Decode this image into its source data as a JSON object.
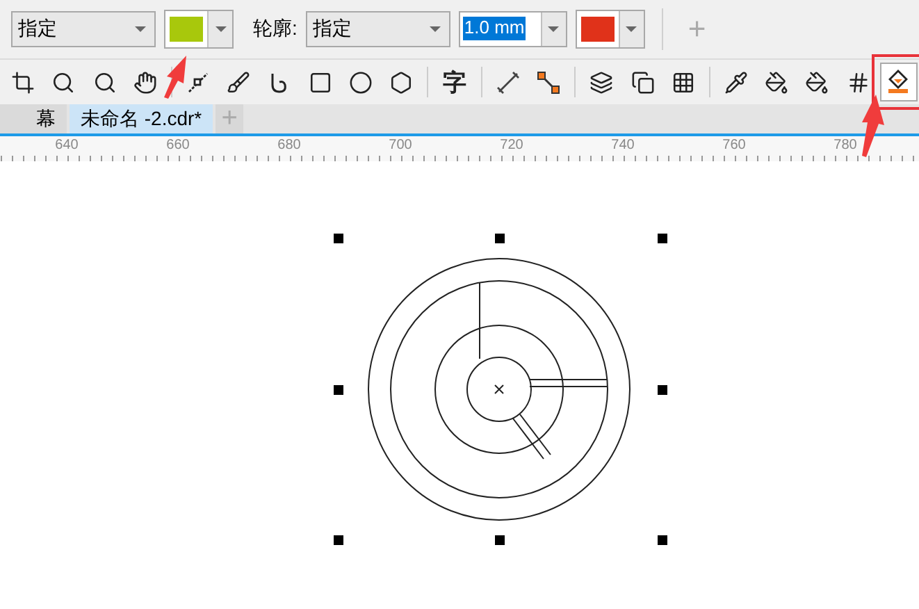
{
  "property_bar": {
    "fill_dropdown": {
      "value": "指定"
    },
    "fill_color": {
      "color": "#a8c80c"
    },
    "outline_label": "轮廓:",
    "outline_dropdown": {
      "value": "指定"
    },
    "outline_width": {
      "value": "1.0 mm",
      "selected": true
    },
    "outline_color": {
      "color": "#e0321a"
    },
    "add_button": "+"
  },
  "toolbar": [
    {
      "kind": "crop",
      "selected": false
    },
    {
      "kind": "zoom",
      "selected": false
    },
    {
      "kind": "zoom",
      "selected": false
    },
    {
      "kind": "hand",
      "selected": false
    },
    {
      "kind": "sep"
    },
    {
      "kind": "line",
      "selected": false
    },
    {
      "kind": "brush",
      "selected": false
    },
    {
      "kind": "curve",
      "selected": false
    },
    {
      "kind": "rect",
      "selected": false
    },
    {
      "kind": "ellipse",
      "selected": false
    },
    {
      "kind": "polygon",
      "selected": false
    },
    {
      "kind": "sep"
    },
    {
      "kind": "text",
      "label": "字",
      "selected": false
    },
    {
      "kind": "sep"
    },
    {
      "kind": "dimension",
      "selected": false
    },
    {
      "kind": "connector",
      "selected": false
    },
    {
      "kind": "sep"
    },
    {
      "kind": "blend",
      "selected": false
    },
    {
      "kind": "shadow",
      "selected": false
    },
    {
      "kind": "transparency",
      "selected": false
    },
    {
      "kind": "sep"
    },
    {
      "kind": "eyedropper",
      "selected": false
    },
    {
      "kind": "fill",
      "selected": false
    },
    {
      "kind": "fill",
      "selected": false
    },
    {
      "kind": "grid",
      "selected": false
    },
    {
      "kind": "smartfill",
      "selected": true
    }
  ],
  "tabs": [
    {
      "label": "幕",
      "selected": false
    },
    {
      "label": "未命名 -2.cdr*",
      "selected": true
    }
  ],
  "new_tab_button": "+",
  "ruler": {
    "labels": [
      "640",
      "660",
      "680",
      "700",
      "720",
      "740",
      "760",
      "780"
    ]
  }
}
